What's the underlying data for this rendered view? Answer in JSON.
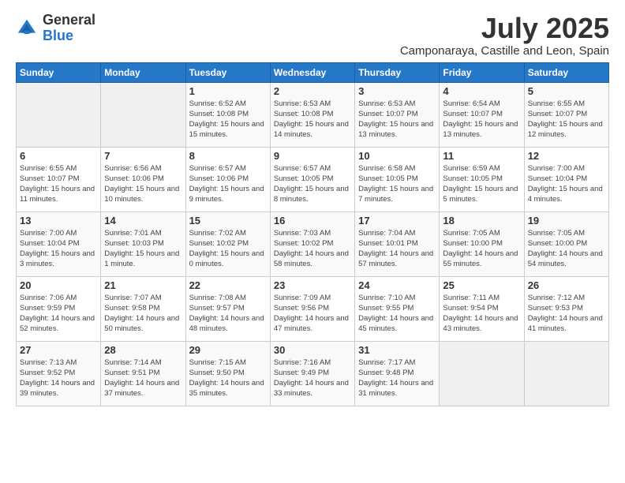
{
  "logo": {
    "general": "General",
    "blue": "Blue"
  },
  "header": {
    "month": "July 2025",
    "location": "Camponaraya, Castille and Leon, Spain"
  },
  "weekdays": [
    "Sunday",
    "Monday",
    "Tuesday",
    "Wednesday",
    "Thursday",
    "Friday",
    "Saturday"
  ],
  "weeks": [
    [
      {
        "day": "",
        "info": ""
      },
      {
        "day": "",
        "info": ""
      },
      {
        "day": "1",
        "info": "Sunrise: 6:52 AM\nSunset: 10:08 PM\nDaylight: 15 hours and 15 minutes."
      },
      {
        "day": "2",
        "info": "Sunrise: 6:53 AM\nSunset: 10:08 PM\nDaylight: 15 hours and 14 minutes."
      },
      {
        "day": "3",
        "info": "Sunrise: 6:53 AM\nSunset: 10:07 PM\nDaylight: 15 hours and 13 minutes."
      },
      {
        "day": "4",
        "info": "Sunrise: 6:54 AM\nSunset: 10:07 PM\nDaylight: 15 hours and 13 minutes."
      },
      {
        "day": "5",
        "info": "Sunrise: 6:55 AM\nSunset: 10:07 PM\nDaylight: 15 hours and 12 minutes."
      }
    ],
    [
      {
        "day": "6",
        "info": "Sunrise: 6:55 AM\nSunset: 10:07 PM\nDaylight: 15 hours and 11 minutes."
      },
      {
        "day": "7",
        "info": "Sunrise: 6:56 AM\nSunset: 10:06 PM\nDaylight: 15 hours and 10 minutes."
      },
      {
        "day": "8",
        "info": "Sunrise: 6:57 AM\nSunset: 10:06 PM\nDaylight: 15 hours and 9 minutes."
      },
      {
        "day": "9",
        "info": "Sunrise: 6:57 AM\nSunset: 10:05 PM\nDaylight: 15 hours and 8 minutes."
      },
      {
        "day": "10",
        "info": "Sunrise: 6:58 AM\nSunset: 10:05 PM\nDaylight: 15 hours and 7 minutes."
      },
      {
        "day": "11",
        "info": "Sunrise: 6:59 AM\nSunset: 10:05 PM\nDaylight: 15 hours and 5 minutes."
      },
      {
        "day": "12",
        "info": "Sunrise: 7:00 AM\nSunset: 10:04 PM\nDaylight: 15 hours and 4 minutes."
      }
    ],
    [
      {
        "day": "13",
        "info": "Sunrise: 7:00 AM\nSunset: 10:04 PM\nDaylight: 15 hours and 3 minutes."
      },
      {
        "day": "14",
        "info": "Sunrise: 7:01 AM\nSunset: 10:03 PM\nDaylight: 15 hours and 1 minute."
      },
      {
        "day": "15",
        "info": "Sunrise: 7:02 AM\nSunset: 10:02 PM\nDaylight: 15 hours and 0 minutes."
      },
      {
        "day": "16",
        "info": "Sunrise: 7:03 AM\nSunset: 10:02 PM\nDaylight: 14 hours and 58 minutes."
      },
      {
        "day": "17",
        "info": "Sunrise: 7:04 AM\nSunset: 10:01 PM\nDaylight: 14 hours and 57 minutes."
      },
      {
        "day": "18",
        "info": "Sunrise: 7:05 AM\nSunset: 10:00 PM\nDaylight: 14 hours and 55 minutes."
      },
      {
        "day": "19",
        "info": "Sunrise: 7:05 AM\nSunset: 10:00 PM\nDaylight: 14 hours and 54 minutes."
      }
    ],
    [
      {
        "day": "20",
        "info": "Sunrise: 7:06 AM\nSunset: 9:59 PM\nDaylight: 14 hours and 52 minutes."
      },
      {
        "day": "21",
        "info": "Sunrise: 7:07 AM\nSunset: 9:58 PM\nDaylight: 14 hours and 50 minutes."
      },
      {
        "day": "22",
        "info": "Sunrise: 7:08 AM\nSunset: 9:57 PM\nDaylight: 14 hours and 48 minutes."
      },
      {
        "day": "23",
        "info": "Sunrise: 7:09 AM\nSunset: 9:56 PM\nDaylight: 14 hours and 47 minutes."
      },
      {
        "day": "24",
        "info": "Sunrise: 7:10 AM\nSunset: 9:55 PM\nDaylight: 14 hours and 45 minutes."
      },
      {
        "day": "25",
        "info": "Sunrise: 7:11 AM\nSunset: 9:54 PM\nDaylight: 14 hours and 43 minutes."
      },
      {
        "day": "26",
        "info": "Sunrise: 7:12 AM\nSunset: 9:53 PM\nDaylight: 14 hours and 41 minutes."
      }
    ],
    [
      {
        "day": "27",
        "info": "Sunrise: 7:13 AM\nSunset: 9:52 PM\nDaylight: 14 hours and 39 minutes."
      },
      {
        "day": "28",
        "info": "Sunrise: 7:14 AM\nSunset: 9:51 PM\nDaylight: 14 hours and 37 minutes."
      },
      {
        "day": "29",
        "info": "Sunrise: 7:15 AM\nSunset: 9:50 PM\nDaylight: 14 hours and 35 minutes."
      },
      {
        "day": "30",
        "info": "Sunrise: 7:16 AM\nSunset: 9:49 PM\nDaylight: 14 hours and 33 minutes."
      },
      {
        "day": "31",
        "info": "Sunrise: 7:17 AM\nSunset: 9:48 PM\nDaylight: 14 hours and 31 minutes."
      },
      {
        "day": "",
        "info": ""
      },
      {
        "day": "",
        "info": ""
      }
    ]
  ]
}
